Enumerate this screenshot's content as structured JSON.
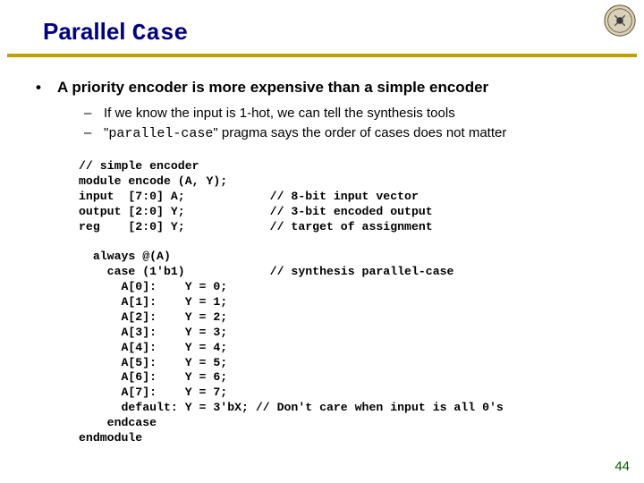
{
  "title": {
    "part1": "Parallel ",
    "part2_mono": "Case"
  },
  "bullet": {
    "dot": "•",
    "text": "A priority encoder is more expensive than a simple encoder"
  },
  "subpoints": [
    {
      "dash": "–",
      "prefix": "",
      "mono": "",
      "suffix": "If we know the input is 1-hot, we can tell the synthesis tools"
    },
    {
      "dash": "–",
      "prefix": "\"",
      "mono": "parallel-case",
      "suffix": "\" pragma says the order of cases does not matter"
    }
  ],
  "code": "// simple encoder\nmodule encode (A, Y);\ninput  [7:0] A;            // 8-bit input vector\noutput [2:0] Y;            // 3-bit encoded output\nreg    [2:0] Y;            // target of assignment\n\n  always @(A)\n    case (1'b1)            // synthesis parallel-case\n      A[0]:    Y = 0;\n      A[1]:    Y = 1;\n      A[2]:    Y = 2;\n      A[3]:    Y = 3;\n      A[4]:    Y = 4;\n      A[5]:    Y = 5;\n      A[6]:    Y = 6;\n      A[7]:    Y = 7;\n      default: Y = 3'bX; // Don't care when input is all 0's\n    endcase\nendmodule",
  "pagenum": "44"
}
